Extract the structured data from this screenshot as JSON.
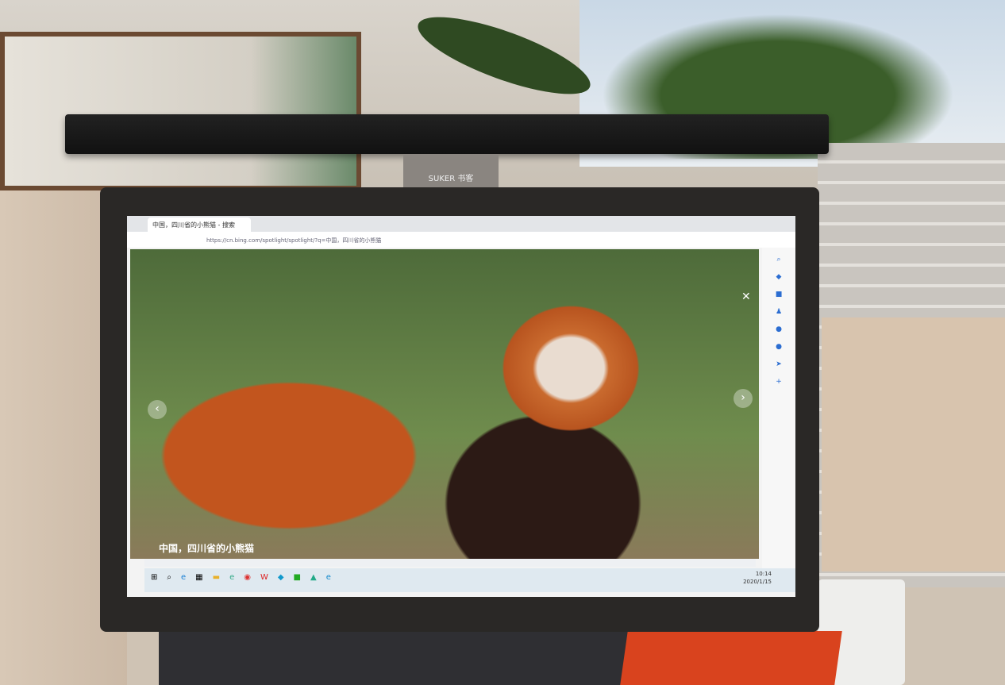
{
  "lamp": {
    "brand": "SUKER 书客"
  },
  "browser": {
    "tab_title": "中国，四川省的小熊猫 - 搜索",
    "url": "https://cn.bing.com/spotlight/spotlight/?q=中国，四川省的小熊猫"
  },
  "viewer": {
    "caption": "中国，四川省的小熊猫",
    "close": "✕",
    "prev": "‹",
    "next": "›"
  },
  "taskbar": {
    "time": "10:14",
    "date": "2020/1/15"
  }
}
